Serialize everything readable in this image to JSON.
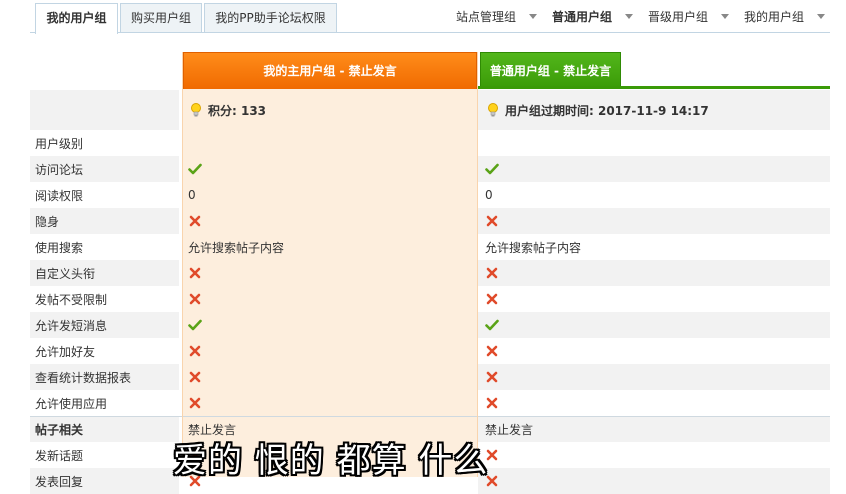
{
  "tabs": [
    {
      "label": "我的用户组",
      "active": true
    },
    {
      "label": "购买用户组",
      "active": false
    },
    {
      "label": "我的PP助手论坛权限",
      "active": false
    }
  ],
  "right_menu": [
    {
      "label": "站点管理组",
      "bold": false
    },
    {
      "label": "普通用户组",
      "bold": true
    },
    {
      "label": "晋级用户组",
      "bold": false
    },
    {
      "label": "我的用户组",
      "bold": false
    }
  ],
  "columns": {
    "main": {
      "header": "我的主用户组 - 禁止发言",
      "info_label": "积分: 133"
    },
    "group": {
      "header": "普通用户组 - 禁止发言",
      "info_label": "用户组过期时间: 2017-11-9 14:17"
    }
  },
  "rows": [
    {
      "label": "用户级别",
      "main": "",
      "group": "",
      "type": "text"
    },
    {
      "label": "访问论坛",
      "main": "yes",
      "group": "yes",
      "type": "icon"
    },
    {
      "label": "阅读权限",
      "main": "0",
      "group": "0",
      "type": "text"
    },
    {
      "label": "隐身",
      "main": "no",
      "group": "no",
      "type": "icon"
    },
    {
      "label": "使用搜索",
      "main": "允许搜索帖子内容",
      "group": "允许搜索帖子内容",
      "type": "text"
    },
    {
      "label": "自定义头衔",
      "main": "no",
      "group": "no",
      "type": "icon"
    },
    {
      "label": "发帖不受限制",
      "main": "no",
      "group": "no",
      "type": "icon"
    },
    {
      "label": "允许发短消息",
      "main": "yes",
      "group": "yes",
      "type": "icon"
    },
    {
      "label": "允许加好友",
      "main": "no",
      "group": "no",
      "type": "icon"
    },
    {
      "label": "查看统计数据报表",
      "main": "no",
      "group": "no",
      "type": "icon"
    },
    {
      "label": "允许使用应用",
      "main": "no",
      "group": "no",
      "type": "icon"
    }
  ],
  "section": {
    "label": "帖子相关",
    "main": "禁止发言",
    "group": "禁止发言"
  },
  "section_rows": [
    {
      "label": "发新话题",
      "main": "no",
      "group": "no",
      "type": "icon"
    },
    {
      "label": "发表回复",
      "main": "no",
      "group": "no",
      "type": "icon"
    }
  ],
  "subtitle": "爱的 恨的 都算 什么",
  "colors": {
    "tab_border": "#c2d5e3",
    "orange": "#f06a00",
    "green": "#3a9a07",
    "yes": "#5aa317",
    "no": "#e04a2a"
  }
}
